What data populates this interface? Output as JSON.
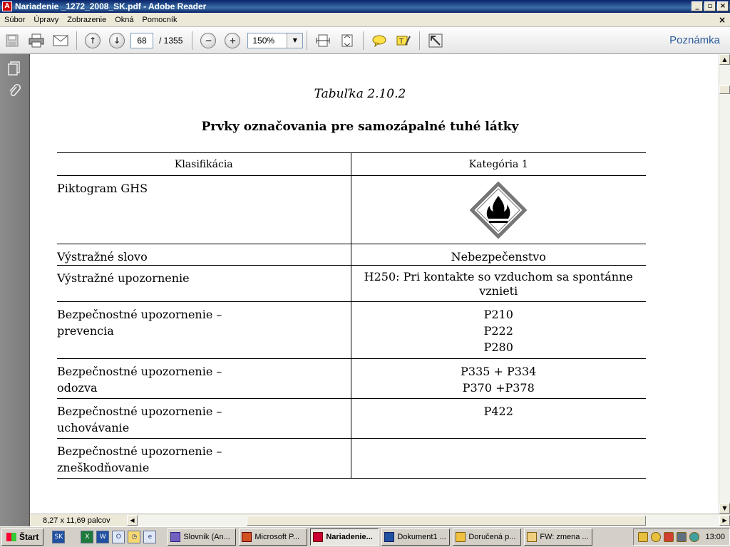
{
  "window": {
    "title": "Nariadenie _1272_2008_SK.pdf - Adobe Reader",
    "app_icon": "pdf-icon"
  },
  "menu": {
    "items": [
      "Súbor",
      "Úpravy",
      "Zobrazenie",
      "Okná",
      "Pomocník"
    ],
    "close_glyph": "×"
  },
  "toolbar": {
    "page_current": "68",
    "page_total": "/ 1355",
    "zoom": "150%",
    "note_label": "Poznámka"
  },
  "document": {
    "caption": "Tabuľka 2.10.2",
    "title": "Prvky označovania pre samozápalné tuhé látky",
    "table": {
      "headers": [
        "Klasifikácia",
        "Kategória 1"
      ],
      "rows": [
        {
          "label": "Piktogram GHS",
          "value": ""
        },
        {
          "label": "Výstražné slovo",
          "value": "Nebezpečenstvo"
        },
        {
          "label": "Výstražné upozornenie",
          "value": "H250: Pri kontakte so vzduchom sa spontánne vznieti"
        },
        {
          "label_1": "Bezpečnostné upozornenie –",
          "label_2": "prevencia",
          "values": [
            "P210",
            "P222",
            "P280"
          ]
        },
        {
          "label_1": "Bezpečnostné upozornenie –",
          "label_2": "odozva",
          "values": [
            "P335 + P334",
            "P370 +P378"
          ]
        },
        {
          "label_1": "Bezpečnostné upozornenie –",
          "label_2": "uchovávanie",
          "values": [
            "P422"
          ]
        },
        {
          "label_1": "Bezpečnostné upozornenie –",
          "label_2": "zneškodňovanie",
          "values": []
        }
      ]
    }
  },
  "status": {
    "page_size": "8,27 x 11,69 palcov"
  },
  "taskbar": {
    "start_label": "Štart",
    "tasks": [
      "Slovník (An...",
      "Microsoft P...",
      "Nariadenie...",
      "Dokument1 ...",
      "Doručená p...",
      "FW: zmena ..."
    ],
    "clock": "13:00"
  },
  "colors": {
    "title_bar": "#0a246a",
    "note_label": "#2a5a9a",
    "pictogram_border": "#e0001a"
  }
}
